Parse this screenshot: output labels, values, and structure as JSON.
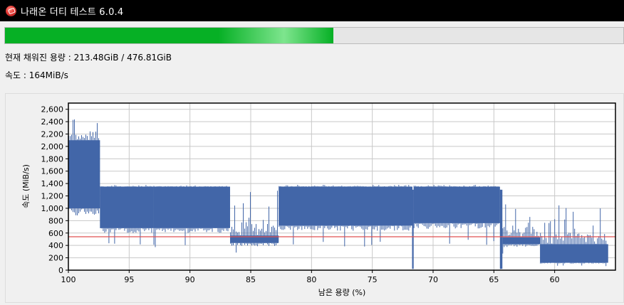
{
  "window": {
    "title": "나래온 더티 테스트 6.0.4",
    "icon": "app-logo-icon"
  },
  "progress": {
    "fraction": 0.5308,
    "color": "#06b025"
  },
  "status": {
    "filled_text": "현재 채워진 용량 : 213.48GiB / 476.81GiB",
    "speed_text": "속도 : 164MiB/s"
  },
  "chart_data": {
    "type": "area",
    "xlabel": "남은 용량 (%)",
    "ylabel": "속도 (MiB/s)",
    "xlim": [
      100,
      55
    ],
    "ylim": [
      0,
      2700
    ],
    "xticks": [
      100,
      95,
      90,
      85,
      80,
      75,
      70,
      65,
      60
    ],
    "yticks": [
      0,
      200,
      400,
      600,
      800,
      1000,
      1200,
      1400,
      1600,
      1800,
      2000,
      2200,
      2400,
      2600
    ],
    "grid": true,
    "series_color": "#4266a8",
    "reference_line": {
      "y": 540,
      "color": "#e05050"
    },
    "bands": [
      {
        "x_start": 100,
        "x_end": 97.4,
        "low": 1000,
        "high": 2100,
        "peak": 2600
      },
      {
        "x_start": 97.4,
        "x_end": 93,
        "low": 680,
        "high": 1350,
        "peak": 1380
      },
      {
        "x_start": 93,
        "x_end": 86.7,
        "low": 680,
        "high": 1350,
        "peak": 1380
      },
      {
        "x_start": 86.7,
        "x_end": 82.7,
        "low": 440,
        "high": 560,
        "peak": 1300
      },
      {
        "x_start": 82.7,
        "x_end": 71.7,
        "low": 720,
        "high": 1350,
        "peak": 1380
      },
      {
        "x_start": 71.7,
        "x_end": 71.6,
        "low": 20,
        "high": 1300,
        "peak": 1300
      },
      {
        "x_start": 71.6,
        "x_end": 64.5,
        "low": 760,
        "high": 1350,
        "peak": 1380
      },
      {
        "x_start": 64.5,
        "x_end": 64.3,
        "low": 20,
        "high": 1300,
        "peak": 1300
      },
      {
        "x_start": 64.3,
        "x_end": 61.2,
        "low": 420,
        "high": 530,
        "peak": 1100
      },
      {
        "x_start": 61.2,
        "x_end": 55.6,
        "low": 120,
        "high": 420,
        "peak": 1050
      }
    ]
  }
}
